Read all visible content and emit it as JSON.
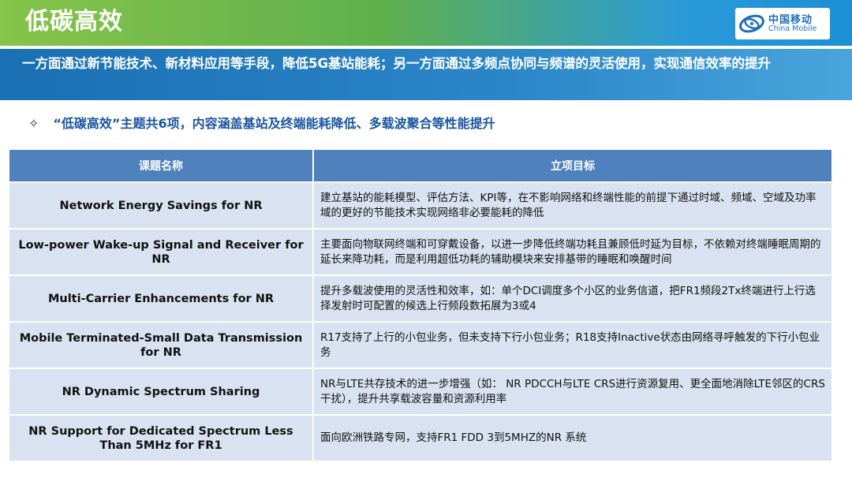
{
  "header": {
    "title": "低碳高效",
    "logo_cn": "中国移动",
    "logo_en": "China Mobile"
  },
  "banner": {
    "text": "一方面通过新节能技术、新材料应用等手段，降低5G基站能耗；另一方面通过多频点协同与频谱的灵活使用，实现通信效率的提升"
  },
  "bullet": {
    "icon": "✧",
    "text": "“低碳高效”主题共6项，内容涵盖基站及终端能耗降低、多载波聚合等性能提升"
  },
  "table": {
    "headers": [
      "课题名称",
      "立项目标"
    ],
    "rows": [
      {
        "name": "Network Energy Savings for NR",
        "goal": "建立基站的能耗模型、评估方法、KPI等，在不影响网络和终端性能的前提下通过时域、频域、空域及功率域的更好的节能技术实现网络非必要能耗的降低"
      },
      {
        "name": "Low-power Wake-up Signal and Receiver for NR",
        "goal": "主要面向物联网终端和可穿戴设备，以进一步降低终端功耗且兼顾低时延为目标，不依赖对终端睡眠周期的延长来降功耗，而是利用超低功耗的辅助模块来安排基带的睡眠和唤醒时间"
      },
      {
        "name": "Multi-Carrier Enhancements for NR",
        "goal": "提升多载波使用的灵活性和效率，如：单个DCI调度多个小区的业务信道，把FR1频段2Tx终端进行上行选择发射时可配置的候选上行频段数拓展为3或4"
      },
      {
        "name": "Mobile Terminated-Small Data Transmission for NR",
        "goal": "R17支持了上行的小包业务，但未支持下行小包业务；R18支持Inactive状态由网络寻呼触发的下行小包业务"
      },
      {
        "name": "NR Dynamic Spectrum Sharing",
        "goal": "NR与LTE共存技术的进一步增强（如： NR PDCCH与LTE CRS进行资源复用、更全面地消除LTE邻区的CRS干扰），提升共享载波容量和资源利用率"
      },
      {
        "name": "NR Support for Dedicated Spectrum Less Than 5MHz for FR1",
        "goal": "面向欧洲铁路专网，支持FR1 FDD 3到5MHZ的NR 系统"
      }
    ]
  }
}
